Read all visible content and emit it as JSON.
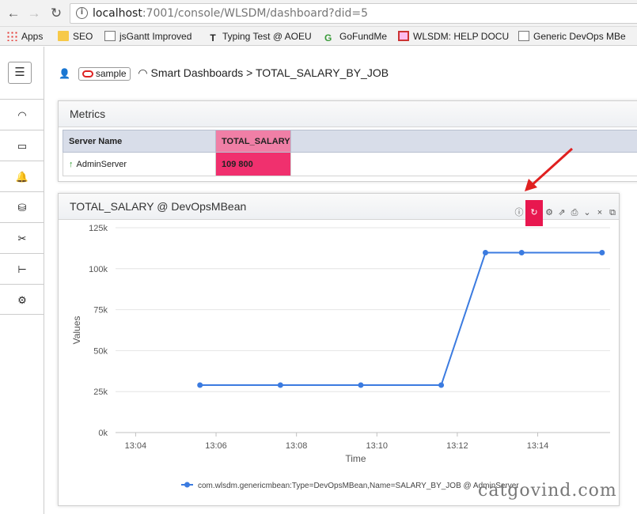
{
  "browser": {
    "url_host": "localhost",
    "url_rest": ":7001/console/WLSDM/dashboard?did=5",
    "bookmarks": [
      {
        "label": "Apps",
        "icon": "apps-icon"
      },
      {
        "label": "SEO",
        "icon": "folder-icon"
      },
      {
        "label": "jsGantt Improved",
        "icon": "page-icon"
      },
      {
        "label": "Typing Test @ AOEU",
        "icon": "typing-icon"
      },
      {
        "label": "GoFundMe",
        "icon": "gofundme-icon"
      },
      {
        "label": "WLSDM: HELP DOCU",
        "icon": "wlsdm-icon"
      },
      {
        "label": "Generic DevOps MBe",
        "icon": "page-icon"
      }
    ]
  },
  "sidebar": {
    "items": [
      {
        "name": "dashboard-gauge-icon",
        "glyph": "◠"
      },
      {
        "name": "monitor-icon",
        "glyph": "▭"
      },
      {
        "name": "alarm-bell-icon",
        "glyph": "🔔"
      },
      {
        "name": "database-icon",
        "glyph": "⛁"
      },
      {
        "name": "tools-icon",
        "glyph": "✂"
      },
      {
        "name": "hierarchy-icon",
        "glyph": "⊢"
      },
      {
        "name": "settings-gear-icon",
        "glyph": "⚙"
      }
    ]
  },
  "breadcrumb": {
    "domain_badge": "sample",
    "section": "Smart Dashboards",
    "separator": ">",
    "page": "TOTAL_SALARY_BY_JOB"
  },
  "metrics": {
    "title": "Metrics",
    "columns": [
      "Server Name",
      "TOTAL_SALARY"
    ],
    "rows": [
      {
        "server": "AdminServer",
        "value": "109 800"
      }
    ]
  },
  "chart_panel": {
    "title": "TOTAL_SALARY @ DevOpsMBean",
    "tools": [
      "info-icon",
      "refresh-icon",
      "settings-icon",
      "export-icon",
      "print-icon",
      "collapse-icon",
      "close-icon",
      "maximize-icon"
    ]
  },
  "chart_data": {
    "type": "line",
    "xlabel": "Time",
    "ylabel": "Values",
    "x_ticks": [
      "13:04",
      "13:06",
      "13:08",
      "13:10",
      "13:12",
      "13:14"
    ],
    "y_ticks": [
      "0k",
      "25k",
      "50k",
      "75k",
      "100k",
      "125k"
    ],
    "ylim": [
      0,
      125000
    ],
    "xlim_minutes": [
      "13:03.5",
      "13:15.8"
    ],
    "series": [
      {
        "name": "com.wlsdm.genericmbean:Type=DevOpsMBean,Name=SALARY_BY_JOB @ AdminServer",
        "color": "#3b7be0",
        "points": [
          {
            "x": "13:05.6",
            "y": 28950
          },
          {
            "x": "13:07.6",
            "y": 28950
          },
          {
            "x": "13:09.6",
            "y": 28950
          },
          {
            "x": "13:11.6",
            "y": 28950
          },
          {
            "x": "13:12.7",
            "y": 109800
          },
          {
            "x": "13:13.6",
            "y": 109800
          },
          {
            "x": "13:15.6",
            "y": 109800
          }
        ]
      }
    ]
  },
  "watermark": "catgovind.com",
  "colors": {
    "highlight": "#f0306e",
    "annotation_arrow": "#e02020",
    "line": "#3b7be0"
  }
}
